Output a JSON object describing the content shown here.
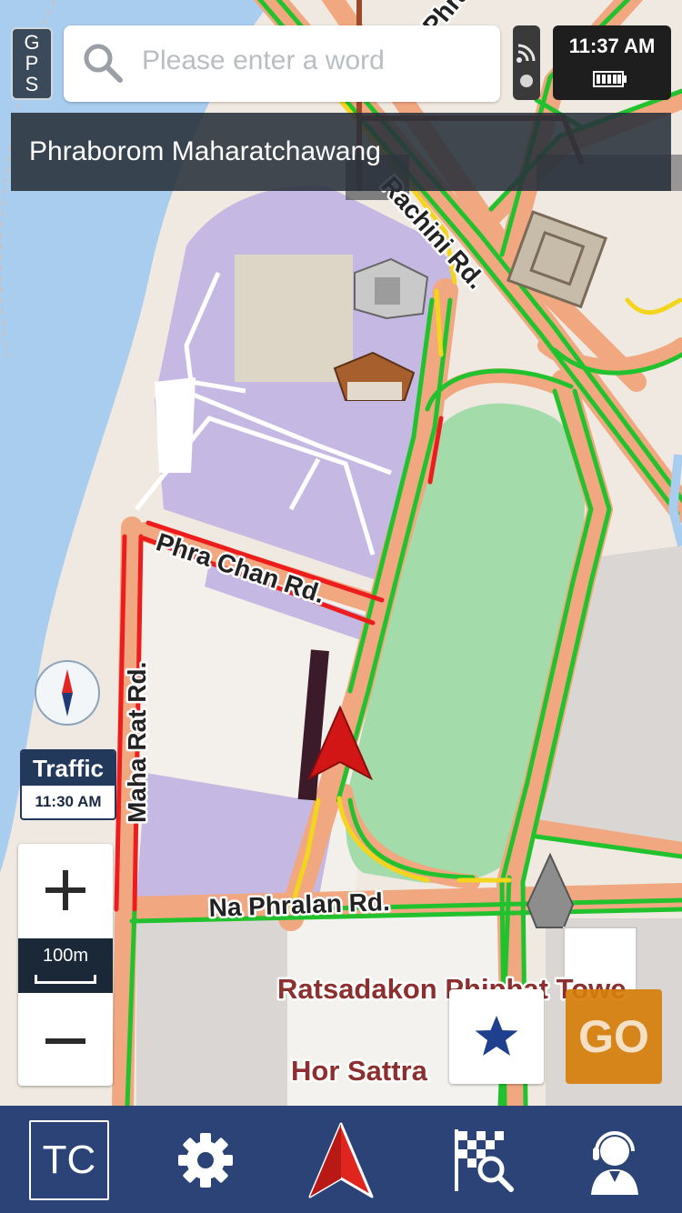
{
  "gps_badge": {
    "letters": [
      "G",
      "P",
      "S"
    ]
  },
  "search": {
    "placeholder": "Please enter a word"
  },
  "status": {
    "time": "11:37 AM"
  },
  "current_street": "Phraborom Maharatchawang",
  "traffic": {
    "title": "Traffic",
    "time": "11:30 AM"
  },
  "zoom": {
    "scale": "100m"
  },
  "map_labels": {
    "phra_top": "Phra",
    "rachini": "Rachini Rd.",
    "phra_chan": "Phra Chan Rd.",
    "maha_rat": "Maha Rat Rd.",
    "na_phralan": "Na Phralan Rd.",
    "ratsadakon": "Ratsadakon Phiphat Towe",
    "hor_sattra": "Hor Sattra"
  },
  "go_label": "GO",
  "bottom_nav": {
    "tc_label": "TC"
  },
  "colors": {
    "nav_bar": "#2b4377",
    "traffic_fast": "#22c22e",
    "traffic_slow": "#f2d51c",
    "traffic_jam": "#ee1d1d",
    "road": "#f1a880",
    "park": "#a4dbab",
    "government_area": "#c5b8e2",
    "river": "#a9cdef",
    "go_button": "#d67e0a"
  },
  "icons": [
    "search-icon",
    "signal-icon",
    "battery-icon",
    "compass-icon",
    "plus-icon",
    "minus-icon",
    "star-icon",
    "settings-gear-icon",
    "navigation-arrow-icon",
    "checkered-flag-search-icon",
    "support-agent-icon"
  ]
}
